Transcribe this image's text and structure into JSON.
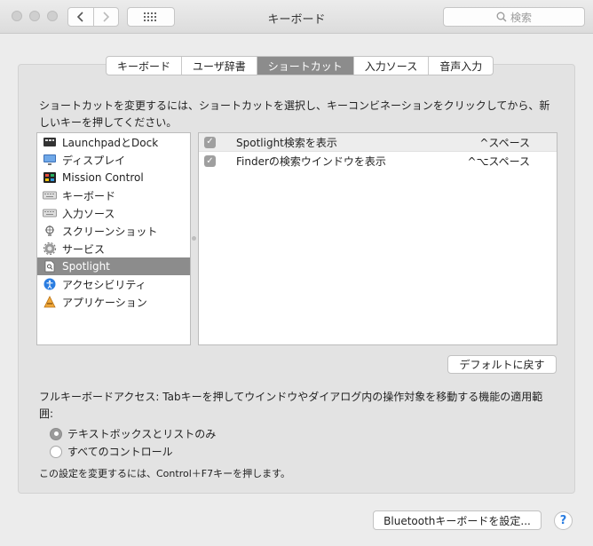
{
  "window": {
    "title": "キーボード"
  },
  "toolbar": {
    "search_placeholder": "検索",
    "back_icon": "chevron-left",
    "forward_icon": "chevron-right",
    "grid_icon": "grid"
  },
  "tabs": [
    {
      "label": "キーボード",
      "active": false
    },
    {
      "label": "ユーザ辞書",
      "active": false
    },
    {
      "label": "ショートカット",
      "active": true
    },
    {
      "label": "入力ソース",
      "active": false
    },
    {
      "label": "音声入力",
      "active": false
    }
  ],
  "description": "ショートカットを変更するには、ショートカットを選択し、キーコンビネーションをクリックしてから、新しいキーを押してください。",
  "categories": [
    {
      "label": "LaunchpadとDock",
      "icon": "launchpad-icon",
      "selected": false
    },
    {
      "label": "ディスプレイ",
      "icon": "display-icon",
      "selected": false
    },
    {
      "label": "Mission Control",
      "icon": "mission-control-icon",
      "selected": false
    },
    {
      "label": "キーボード",
      "icon": "keyboard-icon",
      "selected": false
    },
    {
      "label": "入力ソース",
      "icon": "keyboard-icon",
      "selected": false
    },
    {
      "label": "スクリーンショット",
      "icon": "screenshot-icon",
      "selected": false
    },
    {
      "label": "サービス",
      "icon": "gear-icon",
      "selected": false
    },
    {
      "label": "Spotlight",
      "icon": "spotlight-icon",
      "selected": true
    },
    {
      "label": "アクセシビリティ",
      "icon": "accessibility-icon",
      "selected": false
    },
    {
      "label": "アプリケーション",
      "icon": "app-icon",
      "selected": false
    }
  ],
  "shortcuts": [
    {
      "label": "Spotlight検索を表示",
      "keys": "^スペース",
      "checked": true
    },
    {
      "label": "Finderの検索ウインドウを表示",
      "keys": "^⌥スペース",
      "checked": true
    }
  ],
  "default_button": "デフォルトに戻す",
  "full_keyboard_access": {
    "text": "フルキーボードアクセス: Tabキーを押してウインドウやダイアログ内の操作対象を移動する機能の適用範囲:",
    "options": [
      {
        "label": "テキストボックスとリストのみ",
        "selected": true
      },
      {
        "label": "すべてのコントロール",
        "selected": false
      }
    ],
    "note": "この設定を変更するには、Control＋F7キーを押します。"
  },
  "bluetooth_button": "Bluetoothキーボードを設定...",
  "help_label": "?",
  "colors": {
    "selected_bg": "#8c8c8c",
    "help_accent": "#2a7de1"
  }
}
